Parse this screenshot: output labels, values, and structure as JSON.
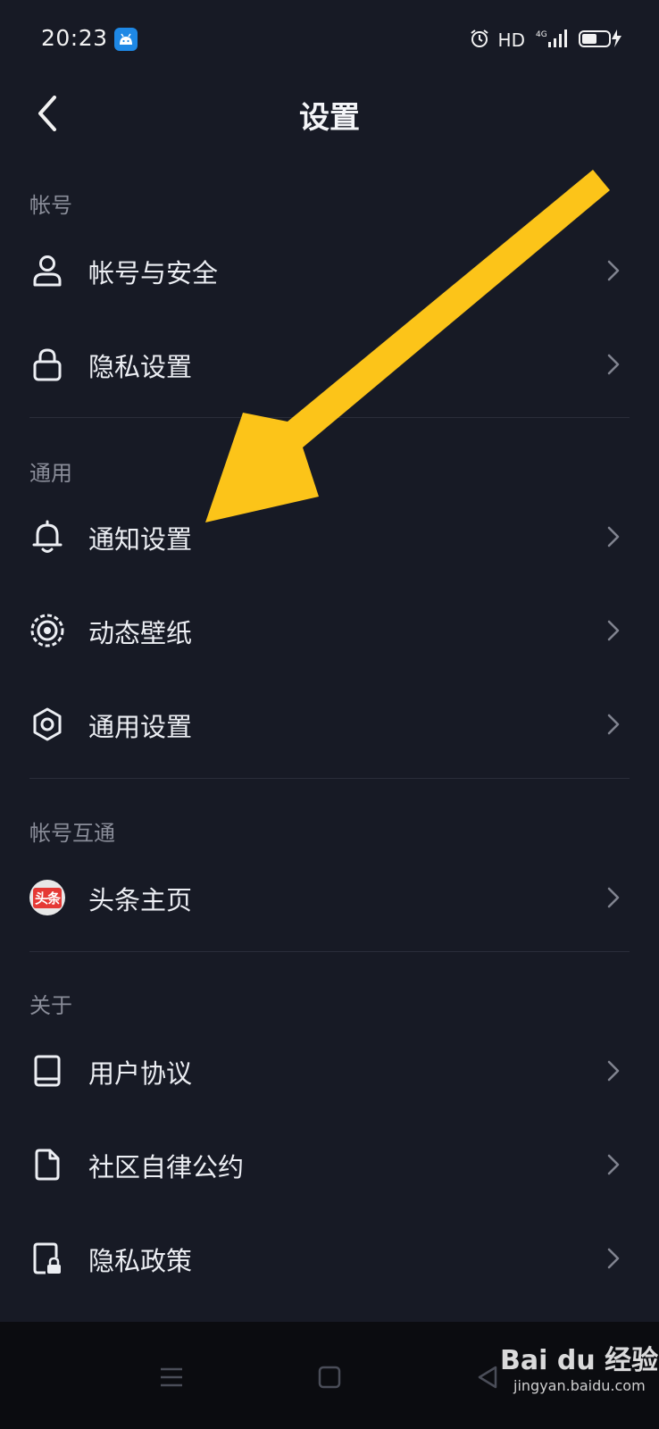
{
  "status_bar": {
    "time": "20:23",
    "network_label": "HD",
    "signal_label": "4G"
  },
  "header": {
    "title": "设置",
    "back_icon": "chevron-left-icon"
  },
  "sections": [
    {
      "title": "帐号",
      "items": [
        {
          "label": "帐号与安全",
          "icon": "user-icon"
        },
        {
          "label": "隐私设置",
          "icon": "lock-icon"
        }
      ]
    },
    {
      "title": "通用",
      "items": [
        {
          "label": "通知设置",
          "icon": "bell-icon"
        },
        {
          "label": "动态壁纸",
          "icon": "wallpaper-icon"
        },
        {
          "label": "通用设置",
          "icon": "gear-icon"
        }
      ]
    },
    {
      "title": "帐号互通",
      "items": [
        {
          "label": "头条主页",
          "icon": "toutiao-logo-icon"
        }
      ]
    },
    {
      "title": "关于",
      "items": [
        {
          "label": "用户协议",
          "icon": "book-icon"
        },
        {
          "label": "社区自律公约",
          "icon": "document-icon"
        },
        {
          "label": "隐私政策",
          "icon": "privacy-document-icon"
        }
      ]
    }
  ],
  "toutiao_logo_text": "头条",
  "watermark": {
    "brand": "Bai du 经验",
    "url": "jingyan.baidu.com"
  },
  "colors": {
    "background": "#171a25",
    "text": "#eceef3",
    "section_title": "#8a8d99",
    "arrow": "#fcc419",
    "nav_bar": "#0b0c10"
  }
}
